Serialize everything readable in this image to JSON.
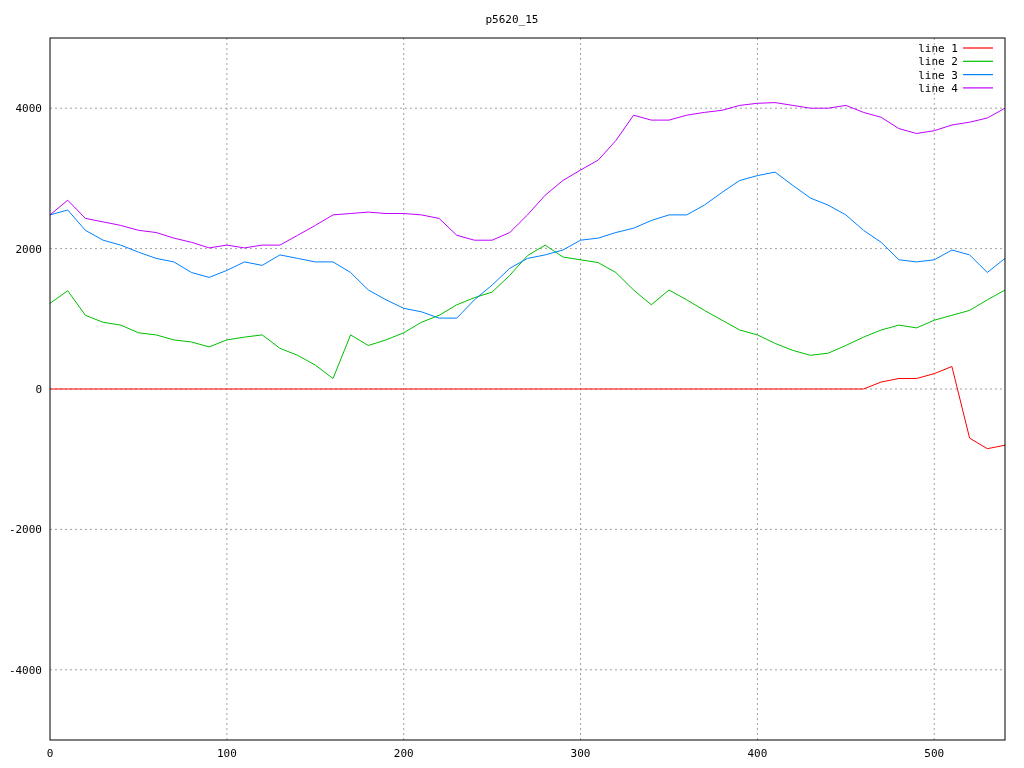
{
  "chart_data": {
    "type": "line",
    "title": "p5620_15",
    "x": [
      0,
      10,
      20,
      30,
      40,
      50,
      60,
      70,
      80,
      90,
      100,
      110,
      120,
      130,
      140,
      150,
      160,
      170,
      180,
      190,
      200,
      210,
      220,
      230,
      240,
      250,
      260,
      270,
      280,
      290,
      300,
      310,
      320,
      330,
      340,
      350,
      360,
      370,
      380,
      390,
      400,
      410,
      420,
      430,
      440,
      450,
      460,
      470,
      480,
      490,
      500,
      510,
      520,
      530,
      540
    ],
    "grid": true,
    "legend": true,
    "xlim": [
      0,
      540
    ],
    "ylim": [
      -5000,
      5000
    ],
    "xticks": [
      0,
      100,
      200,
      300,
      400,
      500
    ],
    "yticks": [
      -4000,
      -2000,
      0,
      2000,
      4000
    ],
    "series": [
      {
        "name": "line 1",
        "color": "#ff0000",
        "values": [
          0,
          0,
          0,
          0,
          0,
          0,
          0,
          0,
          0,
          0,
          0,
          0,
          0,
          0,
          0,
          0,
          0,
          0,
          0,
          0,
          0,
          0,
          0,
          0,
          0,
          0,
          0,
          0,
          0,
          0,
          0,
          0,
          0,
          0,
          0,
          0,
          0,
          0,
          0,
          0,
          0,
          0,
          0,
          0,
          0,
          0,
          0,
          100,
          150,
          150,
          220,
          320,
          -700,
          -850,
          -800
        ]
      },
      {
        "name": "line 2",
        "color": "#00c000",
        "values": [
          1220,
          1400,
          1050,
          950,
          910,
          800,
          770,
          700,
          670,
          600,
          700,
          740,
          770,
          580,
          480,
          340,
          150,
          770,
          620,
          700,
          800,
          950,
          1050,
          1200,
          1300,
          1380,
          1620,
          1900,
          2050,
          1880,
          1840,
          1800,
          1660,
          1410,
          1200,
          1410,
          1270,
          1120,
          980,
          840,
          770,
          650,
          550,
          480,
          510,
          620,
          740,
          840,
          910,
          870,
          980,
          1050,
          1120,
          1270,
          1410
        ]
      },
      {
        "name": "line 3",
        "color": "#0080ff",
        "values": [
          2480,
          2550,
          2260,
          2120,
          2050,
          1950,
          1860,
          1810,
          1660,
          1590,
          1690,
          1810,
          1760,
          1910,
          1860,
          1810,
          1810,
          1660,
          1410,
          1270,
          1150,
          1100,
          1010,
          1010,
          1270,
          1480,
          1720,
          1860,
          1910,
          1980,
          2120,
          2150,
          2230,
          2290,
          2400,
          2480,
          2480,
          2620,
          2800,
          2970,
          3040,
          3090,
          2900,
          2720,
          2620,
          2480,
          2260,
          2090,
          1840,
          1810,
          1840,
          1980,
          1910,
          1660,
          1860
        ]
      },
      {
        "name": "line 4",
        "color": "#c000ff",
        "values": [
          2480,
          2690,
          2430,
          2380,
          2330,
          2260,
          2230,
          2150,
          2090,
          2010,
          2050,
          2010,
          2050,
          2050,
          2190,
          2330,
          2480,
          2500,
          2520,
          2500,
          2500,
          2480,
          2430,
          2190,
          2120,
          2120,
          2230,
          2480,
          2760,
          2970,
          3120,
          3260,
          3540,
          3900,
          3830,
          3830,
          3900,
          3940,
          3970,
          4040,
          4070,
          4080,
          4040,
          4000,
          4000,
          4040,
          3940,
          3870,
          3710,
          3640,
          3680,
          3760,
          3800,
          3860,
          4000
        ]
      }
    ]
  }
}
